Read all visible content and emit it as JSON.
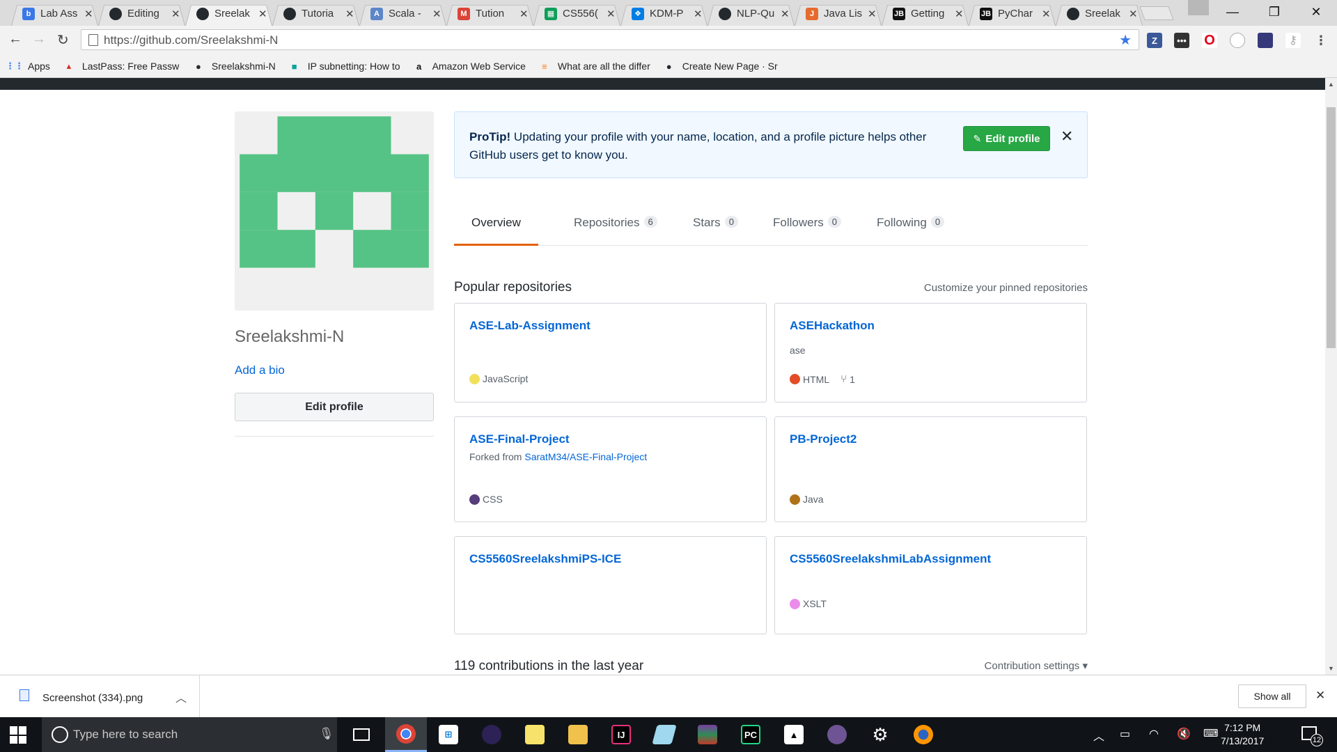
{
  "browser": {
    "tabs": [
      {
        "title": "Lab Ass",
        "icon": "blackboard-icon",
        "color": "#3b78e7",
        "glyph": "b"
      },
      {
        "title": "Editing",
        "icon": "github-icon",
        "color": "#24292e",
        "glyph": ""
      },
      {
        "title": "Sreelak",
        "icon": "github-icon",
        "color": "#24292e",
        "glyph": "",
        "active": true
      },
      {
        "title": "Tutoria",
        "icon": "github-icon",
        "color": "#24292e",
        "glyph": ""
      },
      {
        "title": "Scala -",
        "icon": "scala-icon",
        "color": "#5b86c8",
        "glyph": "A"
      },
      {
        "title": "Tution",
        "icon": "gmail-icon",
        "color": "#db4437",
        "glyph": "M"
      },
      {
        "title": "CS556(",
        "icon": "sheets-icon",
        "color": "#0f9d58",
        "glyph": "▦"
      },
      {
        "title": "KDM-P",
        "icon": "dropbox-icon",
        "color": "#007ee5",
        "glyph": "❖"
      },
      {
        "title": "NLP-Qu",
        "icon": "github-icon",
        "color": "#24292e",
        "glyph": ""
      },
      {
        "title": "Java Lis",
        "icon": "javatpoint-icon",
        "color": "#e66b2e",
        "glyph": "J"
      },
      {
        "title": "Getting",
        "icon": "jetbrains-icon",
        "color": "#111111",
        "glyph": "JB"
      },
      {
        "title": "PyChar",
        "icon": "jetbrains-icon",
        "color": "#111111",
        "glyph": "JB"
      },
      {
        "title": "Sreelak",
        "icon": "github-icon",
        "color": "#24292e",
        "glyph": ""
      }
    ],
    "url": "https://github.com/Sreelakshmi-N",
    "bookmarks": [
      {
        "label": "Apps",
        "icon": "apps-grid-icon"
      },
      {
        "label": "LastPass: Free Passwo",
        "icon": "lastpass-icon"
      },
      {
        "label": "Sreelakshmi-N",
        "icon": "github-icon"
      },
      {
        "label": "IP subnetting: How to",
        "icon": "subnet-icon"
      },
      {
        "label": "Amazon Web Service",
        "icon": "amazon-icon"
      },
      {
        "label": "What are all the differ",
        "icon": "stack-overflow-icon"
      },
      {
        "label": "Create New Page · Sr",
        "icon": "github-icon"
      }
    ]
  },
  "profile": {
    "username": "Sreelakshmi-N",
    "add_bio": "Add a bio",
    "edit_profile": "Edit profile"
  },
  "protip": {
    "lead": "ProTip!",
    "message": " Updating your profile with your name, location, and a profile picture helps other GitHub users get to know you.",
    "button": "Edit profile",
    "close": "✕"
  },
  "nav_tabs": [
    {
      "label": "Overview",
      "count": null,
      "selected": true
    },
    {
      "label": "Repositories",
      "count": "6"
    },
    {
      "label": "Stars",
      "count": "0"
    },
    {
      "label": "Followers",
      "count": "0"
    },
    {
      "label": "Following",
      "count": "0"
    }
  ],
  "popular": {
    "title": "Popular repositories",
    "customize": "Customize your pinned repositories",
    "repos": [
      {
        "name": "ASE-Lab-Assignment",
        "desc": "",
        "language": "JavaScript",
        "lang_color": "#f1e05a"
      },
      {
        "name": "ASEHackathon",
        "desc": "ase",
        "language": "HTML",
        "lang_color": "#e34c26",
        "forks": "1"
      },
      {
        "name": "ASE-Final-Project",
        "forked_prefix": "Forked from ",
        "forked_from": "SaratM34/ASE-Final-Project",
        "language": "CSS",
        "lang_color": "#563d7c"
      },
      {
        "name": "PB-Project2",
        "desc": "",
        "language": "Java",
        "lang_color": "#b07219"
      },
      {
        "name": "CS5560SreelakshmiPS-ICE",
        "desc": "",
        "language": "",
        "lang_color": ""
      },
      {
        "name": "CS5560SreelakshmiLabAssignment",
        "desc": "",
        "language": "XSLT",
        "lang_color": "#eb8ceb"
      }
    ]
  },
  "contributions": {
    "title": "119 contributions in the last year",
    "settings": "Contribution settings ▾"
  },
  "download_bar": {
    "file": "Screenshot (334).png",
    "show_all": "Show all"
  },
  "taskbar": {
    "search_placeholder": "Type here to search",
    "time": "7:12 PM",
    "date": "7/13/2017",
    "notification_count": "12"
  }
}
